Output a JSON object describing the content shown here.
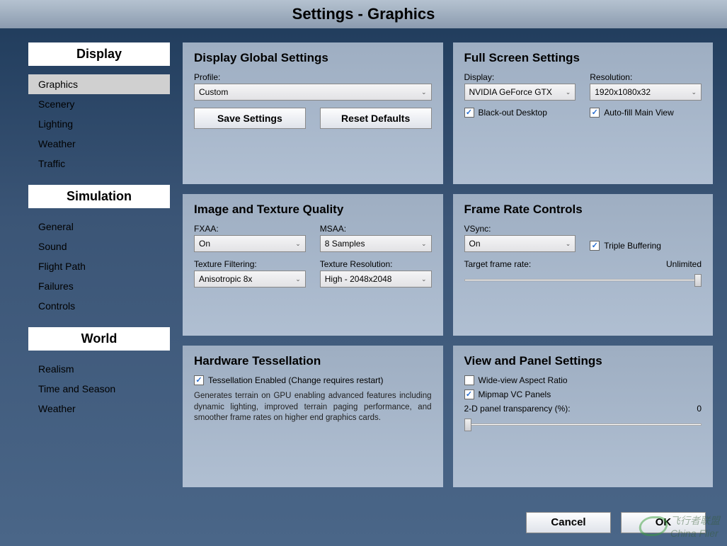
{
  "title": "Settings - Graphics",
  "sidebar": [
    {
      "header": "Display",
      "items": [
        "Graphics",
        "Scenery",
        "Lighting",
        "Weather",
        "Traffic"
      ],
      "active": 0
    },
    {
      "header": "Simulation",
      "items": [
        "General",
        "Sound",
        "Flight Path",
        "Failures",
        "Controls"
      ],
      "active": -1
    },
    {
      "header": "World",
      "items": [
        "Realism",
        "Time and Season",
        "Weather"
      ],
      "active": -1
    }
  ],
  "panels": {
    "globalSettings": {
      "title": "Display Global Settings",
      "profileLabel": "Profile:",
      "profileValue": "Custom",
      "saveBtn": "Save Settings",
      "resetBtn": "Reset Defaults"
    },
    "fullScreen": {
      "title": "Full Screen Settings",
      "displayLabel": "Display:",
      "displayValue": "NVIDIA GeForce GTX",
      "resolutionLabel": "Resolution:",
      "resolutionValue": "1920x1080x32",
      "blackout": {
        "label": "Black-out Desktop",
        "checked": true
      },
      "autofill": {
        "label": "Auto-fill Main View",
        "checked": true
      }
    },
    "imageQuality": {
      "title": "Image and Texture Quality",
      "fxaaLabel": "FXAA:",
      "fxaaValue": "On",
      "msaaLabel": "MSAA:",
      "msaaValue": "8 Samples",
      "texFilterLabel": "Texture Filtering:",
      "texFilterValue": "Anisotropic 8x",
      "texResLabel": "Texture Resolution:",
      "texResValue": "High - 2048x2048"
    },
    "frameRate": {
      "title": "Frame Rate Controls",
      "vsyncLabel": "VSync:",
      "vsyncValue": "On",
      "tripleBuffer": {
        "label": "Triple Buffering",
        "checked": true
      },
      "targetLabel": "Target frame rate:",
      "targetValue": "Unlimited"
    },
    "tessellation": {
      "title": "Hardware Tessellation",
      "enable": {
        "label": "Tessellation Enabled (Change requires restart)",
        "checked": true
      },
      "desc": "Generates terrain on GPU enabling advanced features including dynamic lighting, improved terrain paging performance, and smoother frame rates on higher end graphics cards."
    },
    "viewPanel": {
      "title": "View and Panel Settings",
      "wideView": {
        "label": "Wide-view Aspect Ratio",
        "checked": false
      },
      "mipmap": {
        "label": "Mipmap VC Panels",
        "checked": true
      },
      "transparencyLabel": "2-D panel transparency (%):",
      "transparencyValue": "0"
    }
  },
  "footer": {
    "cancel": "Cancel",
    "ok": "OK"
  },
  "watermark": "飞行者联盟\nChina Flier"
}
